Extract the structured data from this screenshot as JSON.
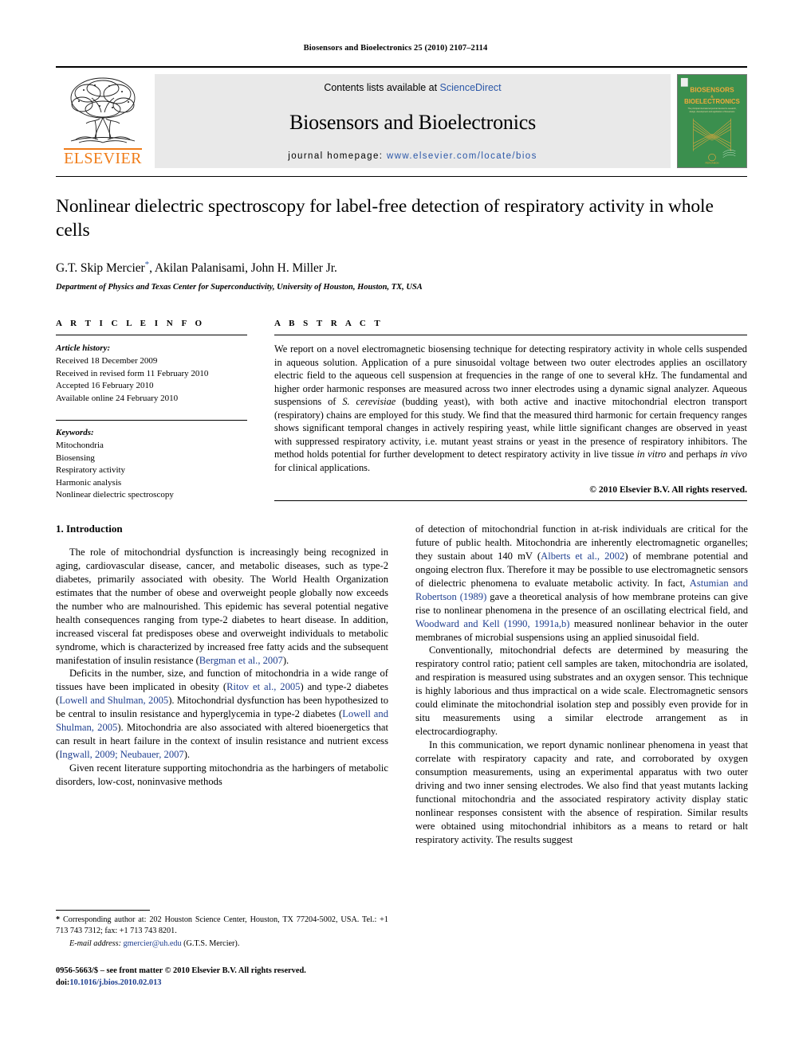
{
  "running_head": "Biosensors and Bioelectronics 25 (2010) 2107–2114",
  "masthead": {
    "publisher_name": "ELSEVIER",
    "contents_prefix": "Contents lists available at ",
    "sciencedirect": "ScienceDirect",
    "journal_title": "Biosensors and Bioelectronics",
    "homepage_prefix": "journal homepage: ",
    "homepage_url": "www.elsevier.com/locate/bios",
    "cover": {
      "line1": "BIOSENSORS",
      "amp": "&",
      "line2": "BIOELECTRONICS",
      "tagline": "The principal international journal devoted to research, design, development and application of biosensors and bioelectronics",
      "footer": "PERGAMON",
      "bg_color": "#3b8f4e",
      "text_color": "#f2a93b"
    }
  },
  "article": {
    "title": "Nonlinear dielectric spectroscopy for label-free detection of respiratory activity in whole cells",
    "authors": "G.T. Skip Mercier",
    "authors_rest": ", Akilan Palanisami, John H. Miller Jr.",
    "corresponding_marker": "*",
    "affiliation": "Department of Physics and Texas Center for Superconductivity, University of Houston, Houston, TX, USA"
  },
  "article_info": {
    "label": "A R T I C L E   I N F O",
    "history_head": "Article history:",
    "history": [
      "Received 18 December 2009",
      "Received in revised form 11 February 2010",
      "Accepted 16 February 2010",
      "Available online 24 February 2010"
    ],
    "keywords_head": "Keywords:",
    "keywords": [
      "Mitochondria",
      "Biosensing",
      "Respiratory activity",
      "Harmonic analysis",
      "Nonlinear dielectric spectroscopy"
    ]
  },
  "abstract": {
    "label": "A B S T R A C T",
    "part1": "We report on a novel electromagnetic biosensing technique for detecting respiratory activity in whole cells suspended in aqueous solution. Application of a pure sinusoidal voltage between two outer electrodes applies an oscillatory electric field to the aqueous cell suspension at frequencies in the range of one to several kHz. The fundamental and higher order harmonic responses are measured across two inner electrodes using a dynamic signal analyzer. Aqueous suspensions of ",
    "italic1": "S. cerevisiae",
    "part2": " (budding yeast), with both active and inactive mitochondrial electron transport (respiratory) chains are employed for this study. We find that the measured third harmonic for certain frequency ranges shows significant temporal changes in actively respiring yeast, while little significant changes are observed in yeast with suppressed respiratory activity, i.e. mutant yeast strains or yeast in the presence of respiratory inhibitors. The method holds potential for further development to detect respiratory activity in live tissue ",
    "italic2": "in vitro",
    "part3": " and perhaps ",
    "italic3": "in vivo",
    "part4": " for clinical applications.",
    "copyright": "© 2010 Elsevier B.V. All rights reserved."
  },
  "introduction": {
    "heading": "1.  Introduction",
    "col1": {
      "p1_a": "The role of mitochondrial dysfunction is increasingly being recognized in aging, cardiovascular disease, cancer, and metabolic diseases, such as type-2 diabetes, primarily associated with obesity. The World Health Organization estimates that the number of obese and overweight people globally now exceeds the number who are malnourished. This epidemic has several potential negative health consequences ranging from type-2 diabetes to heart disease. In addition, increased visceral fat predisposes obese and overweight individuals to metabolic syndrome, which is characterized by increased free fatty acids and the subsequent manifestation of insulin resistance (",
      "p1_ref": "Bergman et al., 2007",
      "p1_b": ").",
      "p2_a": "Deficits in the number, size, and function of mitochondria in a wide range of tissues have been implicated in obesity (",
      "p2_ref1": "Ritov et al., 2005",
      "p2_b": ") and type-2 diabetes (",
      "p2_ref2": "Lowell and Shulman, 2005",
      "p2_c": "). Mitochondrial dysfunction has been hypothesized to be central to insulin resistance and hyperglycemia in type-2 diabetes (",
      "p2_ref3": "Lowell and Shulman, 2005",
      "p2_d": "). Mitochondria are also associated with altered bioenergetics that can result in heart failure in the context of insulin resistance and nutrient excess (",
      "p2_ref4": "Ingwall, 2009; Neubauer, 2007",
      "p2_e": ").",
      "p3": "Given recent literature supporting mitochondria as the harbingers of metabolic disorders, low-cost, noninvasive methods"
    },
    "col2": {
      "p1_a": "of detection of mitochondrial function in at-risk individuals are critical for the future of public health. Mitochondria are inherently electromagnetic organelles; they sustain about 140 mV (",
      "p1_ref1": "Alberts et al., 2002",
      "p1_b": ") of membrane potential and ongoing electron flux. Therefore it may be possible to use electromagnetic sensors of dielectric phenomena to evaluate metabolic activity. In fact, ",
      "p1_ref2": "Astumian and Robertson (1989)",
      "p1_c": " gave a theoretical analysis of how membrane proteins can give rise to nonlinear phenomena in the presence of an oscillating electrical field, and ",
      "p1_ref3": "Woodward and Kell (1990, 1991a,b)",
      "p1_d": " measured nonlinear behavior in the outer membranes of microbial suspensions using an applied sinusoidal field.",
      "p2": "Conventionally, mitochondrial defects are determined by measuring the respiratory control ratio; patient cell samples are taken, mitochondria are isolated, and respiration is measured using substrates and an oxygen sensor. This technique is highly laborious and thus impractical on a wide scale. Electromagnetic sensors could eliminate the mitochondrial isolation step and possibly even provide for in situ measurements using a similar electrode arrangement as in electrocardiography.",
      "p3": "In this communication, we report dynamic nonlinear phenomena in yeast that correlate with respiratory capacity and rate, and corroborated by oxygen consumption measurements, using an experimental apparatus with two outer driving and two inner sensing electrodes. We also find that yeast mutants lacking functional mitochondria and the associated respiratory activity display static nonlinear responses consistent with the absence of respiration. Similar results were obtained using mitochondrial inhibitors as a means to retard or halt respiratory activity. The results suggest"
    }
  },
  "footnotes": {
    "corresponding_star": "*",
    "corresponding": " Corresponding author at: 202 Houston Science Center, Houston, TX 77204-5002, USA. Tel.: +1 713 743 7312; fax: +1 713 743 8201.",
    "email_label": "E-mail address:",
    "email": "gmercier@uh.edu",
    "email_suffix": " (G.T.S. Mercier)."
  },
  "imprint": {
    "line1": "0956-5663/$ – see front matter © 2010 Elsevier B.V. All rights reserved.",
    "doi_label": "doi:",
    "doi": "10.1016/j.bios.2010.02.013"
  }
}
